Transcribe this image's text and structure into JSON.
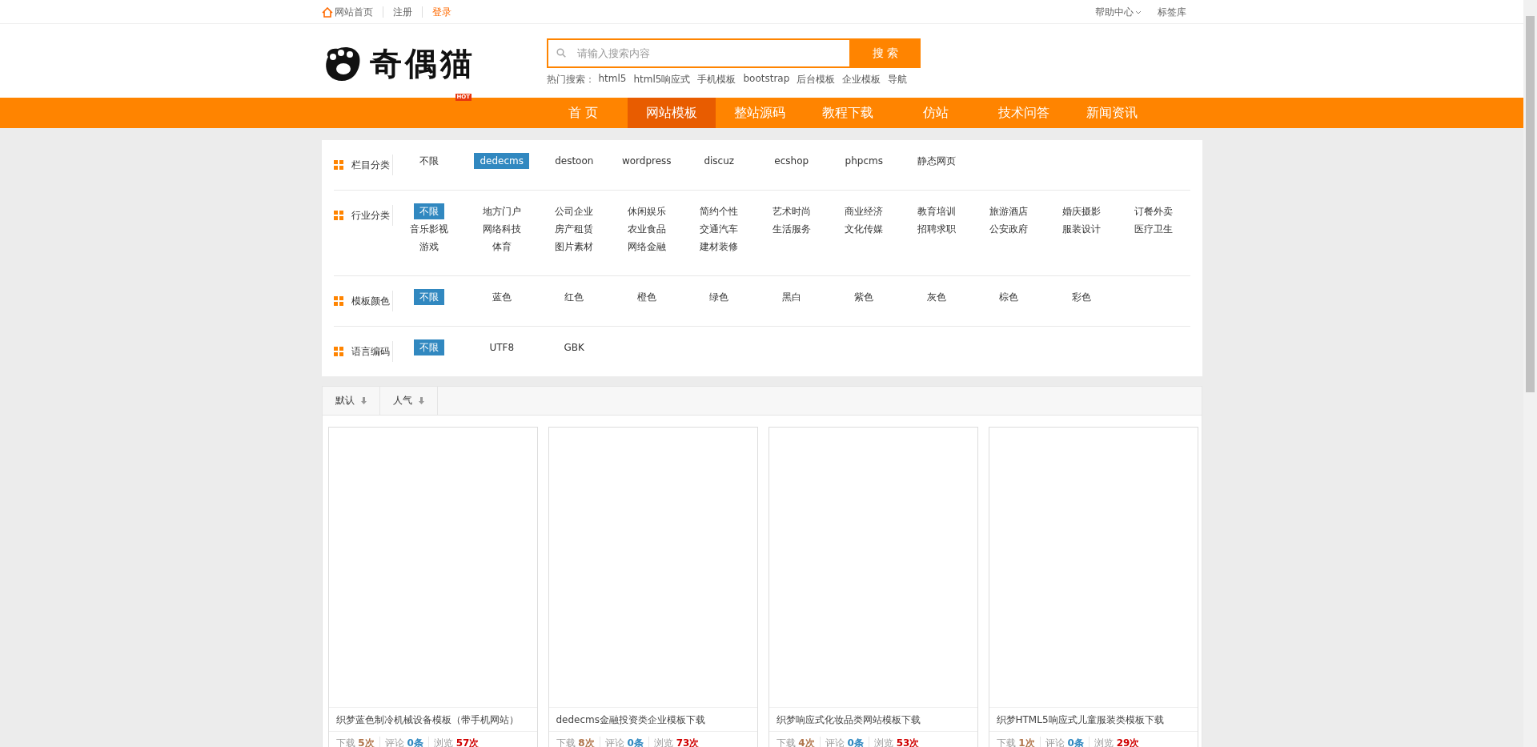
{
  "top_bar": {
    "left_links": [
      {
        "label": "网站首页",
        "kind": "home"
      },
      {
        "label": "注册",
        "kind": "plain"
      },
      {
        "label": "登录",
        "kind": "accent"
      }
    ],
    "right_links": [
      {
        "label": "帮助中心",
        "kind": "dropdown"
      },
      {
        "label": "标签库",
        "kind": "plain"
      }
    ]
  },
  "logo": {
    "text": "奇偶猫",
    "badge": "HOT"
  },
  "search": {
    "placeholder": "请输入搜索内容",
    "button": "搜 索",
    "hot_label": "热门搜索：",
    "hot_terms": [
      "html5",
      "html5响应式",
      "手机模板",
      "bootstrap",
      "后台模板",
      "企业模板",
      "导航"
    ]
  },
  "nav": [
    {
      "label": "首 页",
      "selected": false
    },
    {
      "label": "网站模板",
      "selected": true
    },
    {
      "label": "整站源码",
      "selected": false
    },
    {
      "label": "教程下载",
      "selected": false
    },
    {
      "label": "仿站",
      "selected": false
    },
    {
      "label": "技术问答",
      "selected": false
    },
    {
      "label": "新闻资讯",
      "selected": false
    }
  ],
  "filters": [
    {
      "label": "栏目分类",
      "options": [
        {
          "label": "不限",
          "selected": false
        },
        {
          "label": "dedecms",
          "selected": true
        },
        {
          "label": "destoon",
          "selected": false
        },
        {
          "label": "wordpress",
          "selected": false
        },
        {
          "label": "discuz",
          "selected": false
        },
        {
          "label": "ecshop",
          "selected": false
        },
        {
          "label": "phpcms",
          "selected": false
        },
        {
          "label": "静态网页",
          "selected": false
        }
      ]
    },
    {
      "label": "行业分类",
      "options": [
        {
          "label": "不限",
          "selected": true
        },
        {
          "label": "地方门户",
          "selected": false
        },
        {
          "label": "公司企业",
          "selected": false
        },
        {
          "label": "休闲娱乐",
          "selected": false
        },
        {
          "label": "简约个性",
          "selected": false
        },
        {
          "label": "艺术时尚",
          "selected": false
        },
        {
          "label": "商业经济",
          "selected": false
        },
        {
          "label": "教育培训",
          "selected": false
        },
        {
          "label": "旅游酒店",
          "selected": false
        },
        {
          "label": "婚庆摄影",
          "selected": false
        },
        {
          "label": "订餐外卖",
          "selected": false
        },
        {
          "label": "音乐影视",
          "selected": false
        },
        {
          "label": "网络科技",
          "selected": false
        },
        {
          "label": "房产租赁",
          "selected": false
        },
        {
          "label": "农业食品",
          "selected": false
        },
        {
          "label": "交通汽车",
          "selected": false
        },
        {
          "label": "生活服务",
          "selected": false
        },
        {
          "label": "文化传媒",
          "selected": false
        },
        {
          "label": "招聘求职",
          "selected": false
        },
        {
          "label": "公安政府",
          "selected": false
        },
        {
          "label": "服装设计",
          "selected": false
        },
        {
          "label": "医疗卫生",
          "selected": false
        },
        {
          "label": "游戏",
          "selected": false
        },
        {
          "label": "体育",
          "selected": false
        },
        {
          "label": "图片素材",
          "selected": false
        },
        {
          "label": "网络金融",
          "selected": false
        },
        {
          "label": "建材装修",
          "selected": false
        }
      ]
    },
    {
      "label": "模板颜色",
      "options": [
        {
          "label": "不限",
          "selected": true
        },
        {
          "label": "蓝色",
          "selected": false
        },
        {
          "label": "红色",
          "selected": false
        },
        {
          "label": "橙色",
          "selected": false
        },
        {
          "label": "绿色",
          "selected": false
        },
        {
          "label": "黑白",
          "selected": false
        },
        {
          "label": "紫色",
          "selected": false
        },
        {
          "label": "灰色",
          "selected": false
        },
        {
          "label": "棕色",
          "selected": false
        },
        {
          "label": "彩色",
          "selected": false
        }
      ]
    },
    {
      "label": "语言编码",
      "options": [
        {
          "label": "不限",
          "selected": true
        },
        {
          "label": "UTF8",
          "selected": false
        },
        {
          "label": "GBK",
          "selected": false
        }
      ]
    }
  ],
  "sort_tabs": [
    {
      "label": "默认"
    },
    {
      "label": "人气"
    }
  ],
  "cards": [
    {
      "title": "织梦蓝色制冷机械设备模板（带手机网站）",
      "downloads_label": "下载",
      "downloads": "5次",
      "comments_label": "评论",
      "comments": "0条",
      "views_label": "浏览",
      "views": "57次"
    },
    {
      "title": "dedecms金融投资类企业模板下载",
      "downloads_label": "下载",
      "downloads": "8次",
      "comments_label": "评论",
      "comments": "0条",
      "views_label": "浏览",
      "views": "73次"
    },
    {
      "title": "织梦响应式化妆品类网站模板下载",
      "downloads_label": "下载",
      "downloads": "4次",
      "comments_label": "评论",
      "comments": "0条",
      "views_label": "浏览",
      "views": "53次"
    },
    {
      "title": "织梦HTML5响应式儿童服装类模板下载",
      "downloads_label": "下载",
      "downloads": "1次",
      "comments_label": "评论",
      "comments": "0条",
      "views_label": "浏览",
      "views": "29次"
    }
  ]
}
